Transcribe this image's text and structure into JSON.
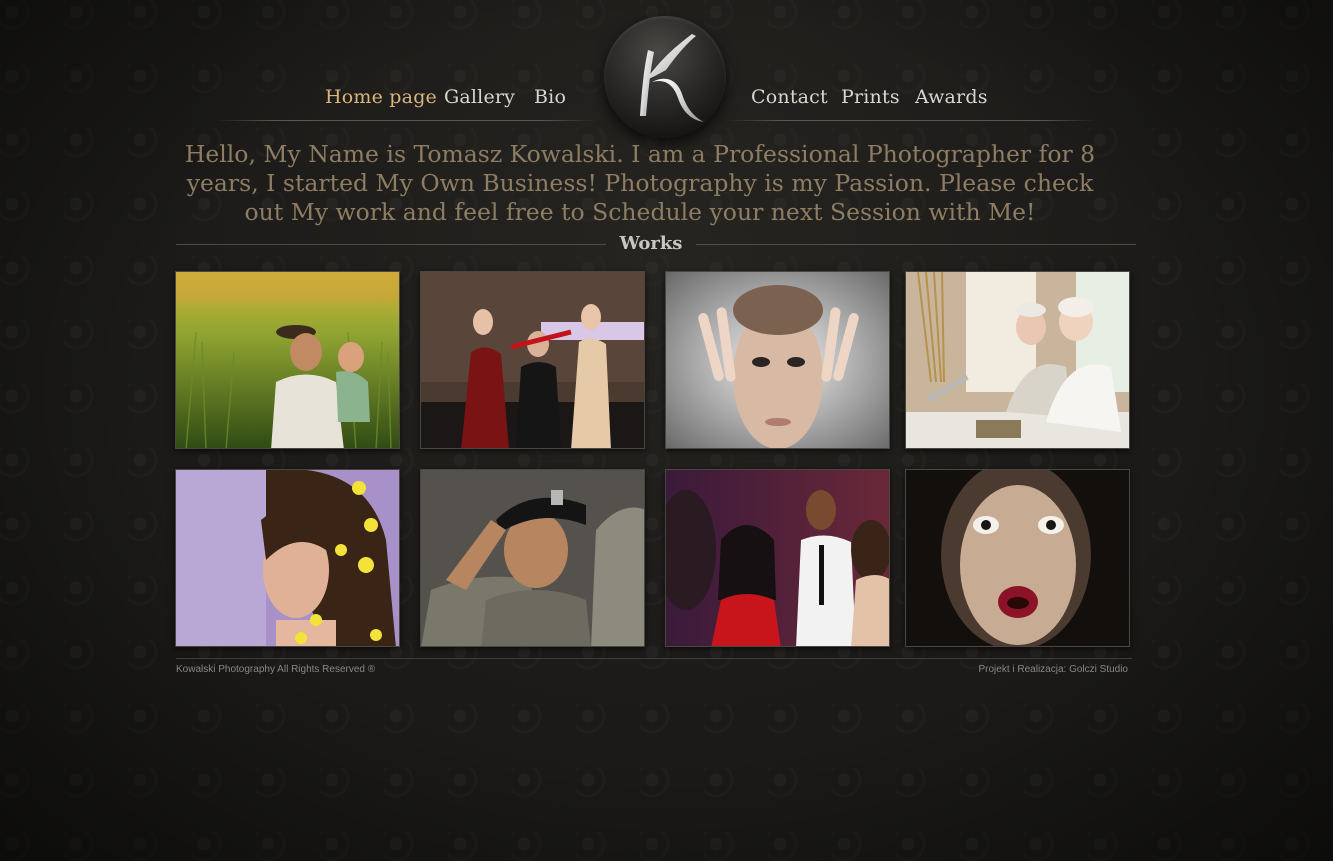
{
  "nav": {
    "left_items": [
      {
        "label": "Home page",
        "active": true
      },
      {
        "label": "Gallery",
        "active": false
      },
      {
        "label": "Bio",
        "active": false
      }
    ],
    "right_items": [
      {
        "label": "Contact",
        "active": false
      },
      {
        "label": "Prints",
        "active": false
      },
      {
        "label": "Awards",
        "active": false
      }
    ]
  },
  "logo": {
    "letter": "K"
  },
  "intro": {
    "text": "Hello, My Name is Tomasz Kowalski. I am a Professional Photographer for 8 years, I started My Own Business! Photography is my Passion. Please check out My work and feel free to Schedule your next Session with Me!"
  },
  "works": {
    "title": "Works",
    "thumbnails": [
      {
        "subject": "father-and-child-in-field"
      },
      {
        "subject": "group-fashion-portrait"
      },
      {
        "subject": "beauty-face-hands"
      },
      {
        "subject": "elderly-couple-laptop"
      },
      {
        "subject": "woman-with-flowers"
      },
      {
        "subject": "soldier-salute"
      },
      {
        "subject": "nightclub-party"
      },
      {
        "subject": "horror-face-portrait"
      }
    ]
  },
  "footer": {
    "copyright": "Kowalski Photography All Rights Reserved ®",
    "credit": "Projekt i Realizacja: Golczi Studio"
  },
  "colors": {
    "background": "#1b1a18",
    "nav_text": "#d9d6d0",
    "nav_active": "#d8b77c",
    "intro_text": "#8e7d63"
  }
}
